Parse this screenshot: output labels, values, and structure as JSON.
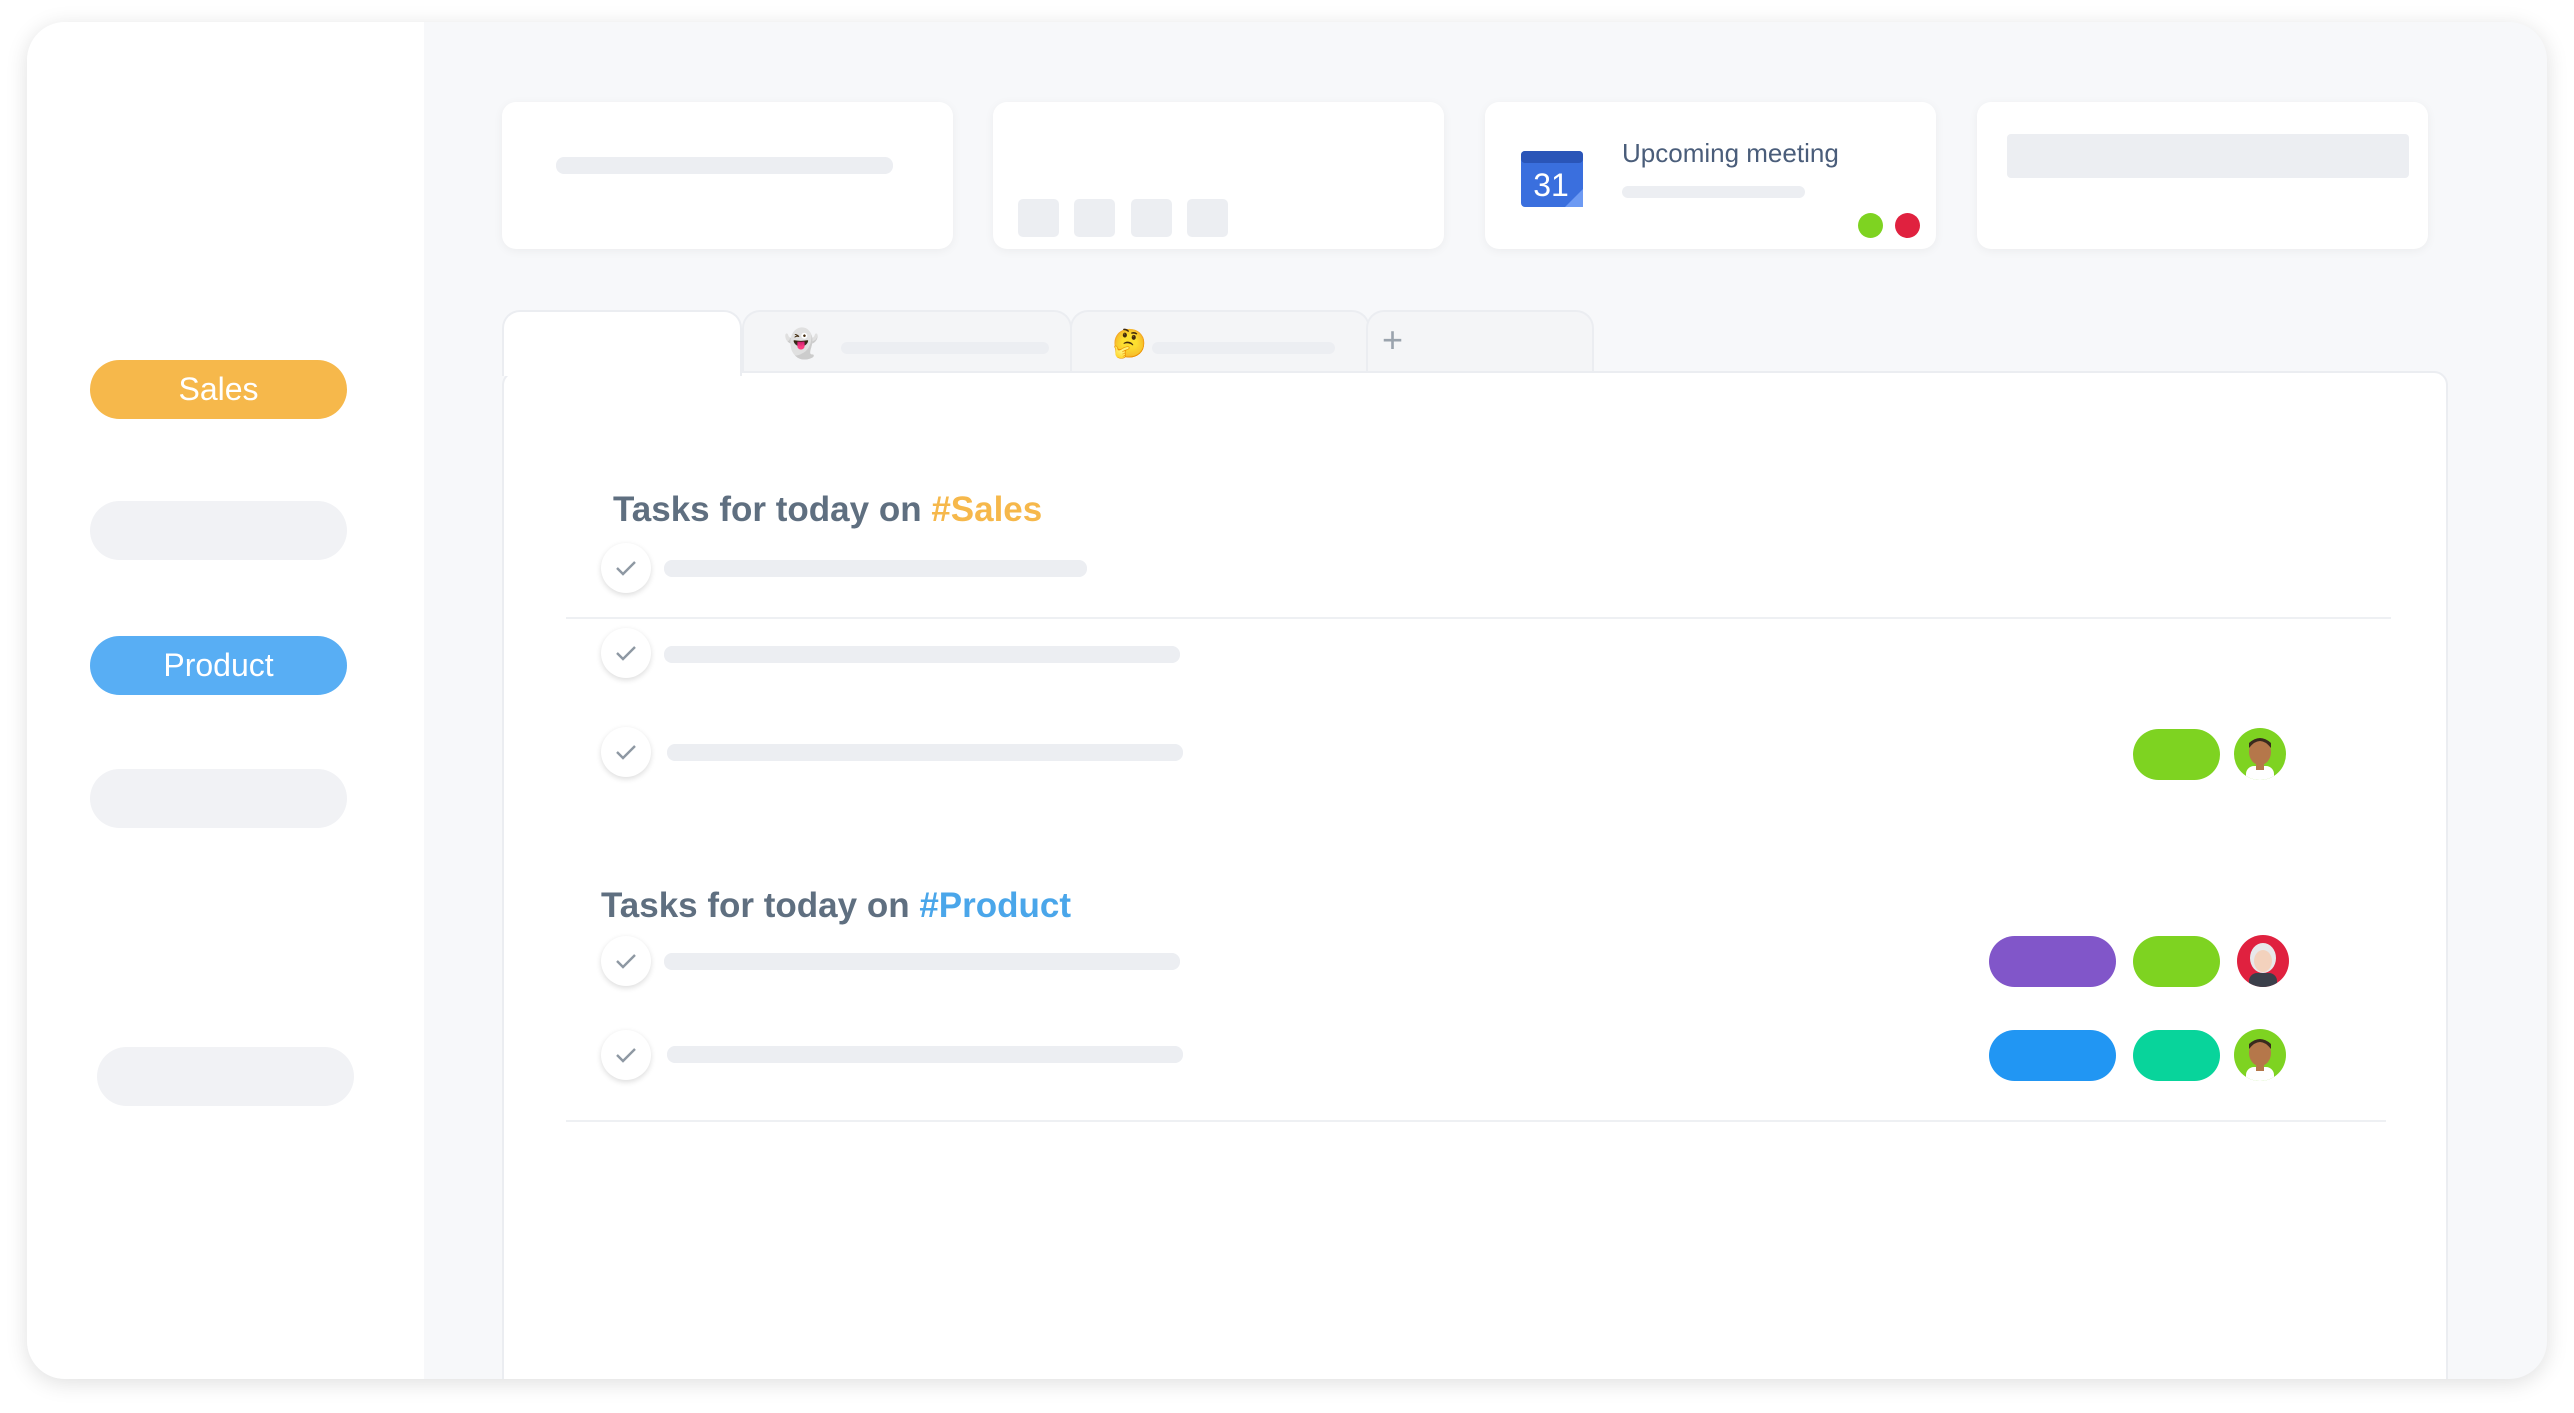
{
  "sidebar": {
    "items": [
      {
        "label": "Sales",
        "color": "#f6b84b"
      },
      {
        "label": ""
      },
      {
        "label": "Product",
        "color": "#58aef4"
      },
      {
        "label": ""
      },
      {
        "label": ""
      }
    ]
  },
  "cards": {
    "meeting": {
      "icon": "calendar-icon",
      "date": "31",
      "label": "Upcoming meeting",
      "status_colors": [
        "#7ed321",
        "#e0213f"
      ]
    }
  },
  "tabs": {
    "items": [
      {
        "icon": "ghost-emoji",
        "glyph": "👻"
      },
      {
        "icon": "thinking-face-emoji",
        "glyph": "🤔"
      }
    ],
    "add_label": "+"
  },
  "sections": [
    {
      "heading_prefix": "Tasks for today on ",
      "heading_tag": "#Sales",
      "tag_color": "#f6b84b",
      "tasks": [
        {
          "tags": [],
          "avatar": null
        },
        {
          "tags": [],
          "avatar": null
        },
        {
          "tags": [
            "#7ed321"
          ],
          "avatar": "man-avatar"
        }
      ]
    },
    {
      "heading_prefix": "Tasks for today on ",
      "heading_tag": "#Product",
      "tag_color": "#4aa6ea",
      "tasks": [
        {
          "tags": [
            "#8156c9",
            "#7ed321"
          ],
          "avatar": "woman-avatar"
        },
        {
          "tags": [
            "#2196f3",
            "#08d49b"
          ],
          "avatar": "man-avatar"
        }
      ]
    }
  ]
}
